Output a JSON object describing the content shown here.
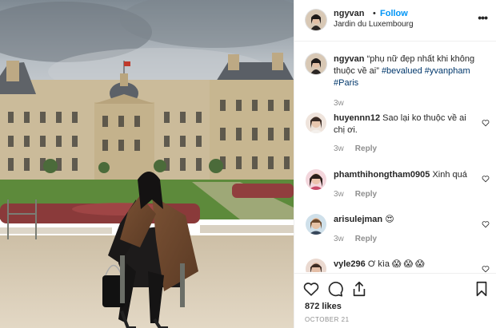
{
  "post": {
    "username": "ngyvan",
    "separator": "•",
    "follow_label": "Follow",
    "location": "Jardin du Luxembourg",
    "more_label": "•••"
  },
  "photo": {
    "description_icon": "post-photo"
  },
  "caption": {
    "username": "ngyvan",
    "text": "“phụ nữ đẹp nhất khi không thuộc về ai”",
    "tags": [
      "#bevalued",
      "#yvanpham",
      "#Paris"
    ],
    "time": "3w"
  },
  "comments": [
    {
      "username": "huyennn12",
      "text": "Sao lại ko thuộc về ai chị ơi.",
      "time": "3w",
      "reply_label": "Reply"
    },
    {
      "username": "phamthihongtham0905",
      "text": "Xinh quá",
      "time": "3w",
      "reply_label": "Reply"
    },
    {
      "username": "arisulejman",
      "text": "😍",
      "time": "3w",
      "reply_label": "Reply"
    },
    {
      "username": "vyle296",
      "text": "Ơ kìa 😱 😱 😱",
      "time": "",
      "reply_label": ""
    }
  ],
  "actions": {
    "icons": [
      "heart-icon",
      "comment-icon",
      "share-icon",
      "bookmark-icon"
    ],
    "likes": "872 likes",
    "date": "OCTOBER 21"
  },
  "colors": {
    "accent": "#0095f6",
    "hashtag": "#00376b",
    "muted": "#8e8e8e",
    "border": "#efefef"
  }
}
